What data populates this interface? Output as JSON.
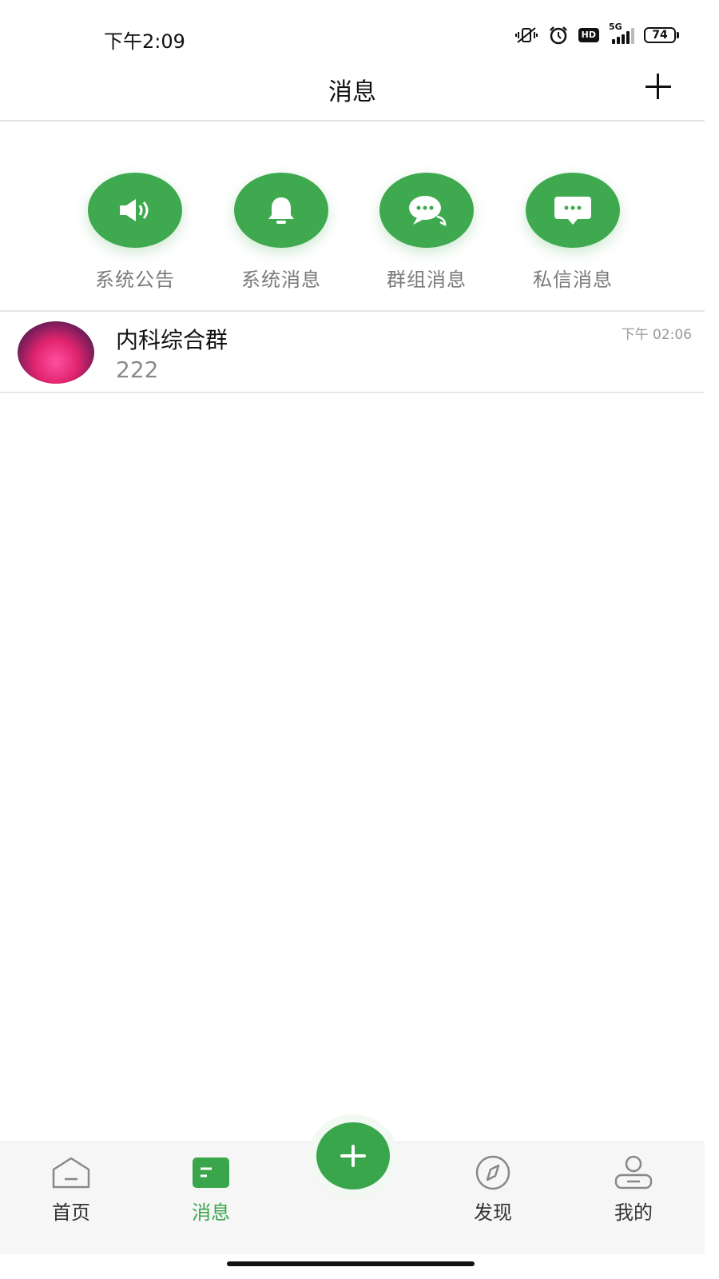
{
  "status_bar": {
    "time": "下午2:09",
    "network": "5G",
    "battery": "74",
    "icons": [
      "vibrate-off-icon",
      "alarm-icon",
      "hd-icon",
      "signal-icon",
      "battery-icon"
    ]
  },
  "header": {
    "title": "消息",
    "add_icon": "plus-icon"
  },
  "quick_entries": [
    {
      "label": "系统公告",
      "icon": "speaker-icon"
    },
    {
      "label": "系统消息",
      "icon": "bell-icon"
    },
    {
      "label": "群组消息",
      "icon": "chat-bubble-icon"
    },
    {
      "label": "私信消息",
      "icon": "message-icon"
    }
  ],
  "conversations": [
    {
      "title": "内科综合群",
      "last_message": "222",
      "time": "下午 02:06"
    }
  ],
  "bottom_nav": {
    "items": [
      {
        "label": "首页",
        "icon": "home-icon",
        "active": false
      },
      {
        "label": "消息",
        "icon": "message-tab-icon",
        "active": true
      },
      {
        "label": "发现",
        "icon": "compass-icon",
        "active": false
      },
      {
        "label": "我的",
        "icon": "profile-icon",
        "active": false
      }
    ],
    "center_button_icon": "plus-icon"
  },
  "colors": {
    "accent": "#3ea94e",
    "active_tab": "#3aa64c",
    "muted_text": "#8a8a8a"
  }
}
